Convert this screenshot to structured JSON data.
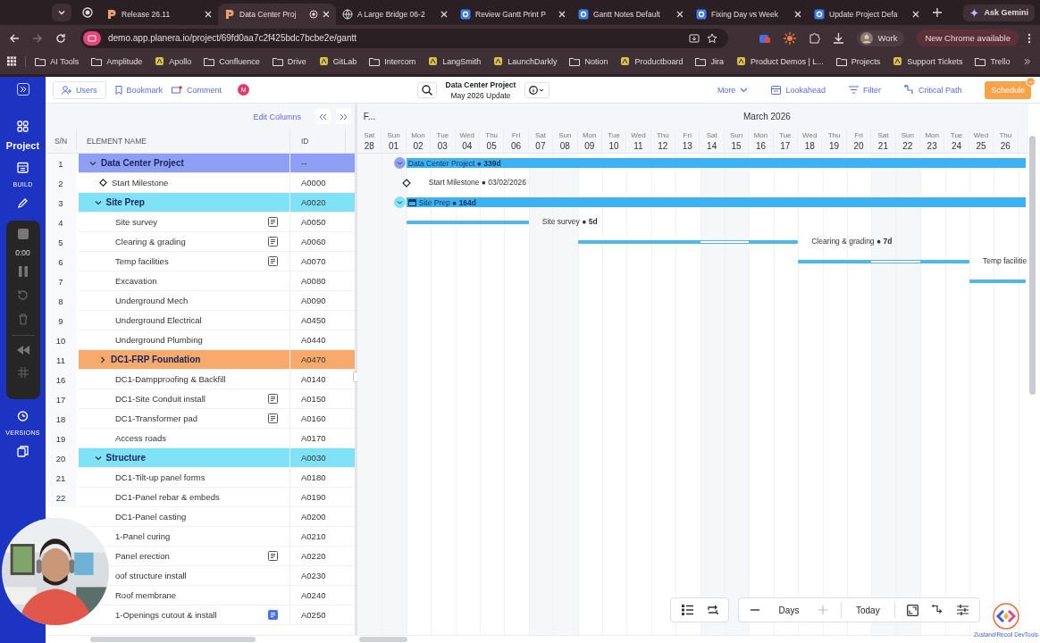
{
  "browser": {
    "tabs": [
      {
        "title": "Release 26.11",
        "kind": "planera",
        "selected": false
      },
      {
        "title": "Data Center Proj",
        "kind": "planera",
        "selected": true
      },
      {
        "title": "A Large Bridge 06-2",
        "kind": "globe",
        "selected": false
      },
      {
        "title": "Review Gantt Print P",
        "kind": "doc",
        "selected": false
      },
      {
        "title": "Gantt Notes Default",
        "kind": "doc",
        "selected": false
      },
      {
        "title": "Fixing Day vs Week",
        "kind": "doc",
        "selected": false
      },
      {
        "title": "Update Project Defa",
        "kind": "doc",
        "selected": false
      }
    ],
    "gemini_button": "Ask Gemini",
    "url": "demo.app.planera.io/project/69fd0aa7c2f425bdc7bcbe2e/gantt",
    "profile": "Work",
    "update_button": "New Chrome available",
    "bookmarks": [
      {
        "label": "AI Tools",
        "kind": "folder"
      },
      {
        "label": "Amplitude",
        "kind": "folder"
      },
      {
        "label": "Apollo",
        "kind": "site"
      },
      {
        "label": "Confluence",
        "kind": "folder"
      },
      {
        "label": "Drive",
        "kind": "folder"
      },
      {
        "label": "GitLab",
        "kind": "site"
      },
      {
        "label": "Intercom",
        "kind": "folder"
      },
      {
        "label": "LangSmith",
        "kind": "site"
      },
      {
        "label": "LaunchDarkly",
        "kind": "site"
      },
      {
        "label": "Notion",
        "kind": "folder"
      },
      {
        "label": "Productboard",
        "kind": "site"
      },
      {
        "label": "Jira",
        "kind": "folder"
      },
      {
        "label": "Product Demos | L...",
        "kind": "site"
      },
      {
        "label": "Projects",
        "kind": "folder"
      },
      {
        "label": "Support Tickets",
        "kind": "site"
      },
      {
        "label": "Trello",
        "kind": "folder"
      }
    ]
  },
  "sidebar": {
    "project_label": "Project",
    "build_label": "BUILD",
    "versions_label": "VERSIONS",
    "recorder_time": "0:00"
  },
  "toolbar": {
    "users": "Users",
    "bookmark": "Bookmark",
    "comment": "Comment",
    "avatar": "M",
    "project_title": "Data Center Project",
    "update_name": "May 2026 Update",
    "more": "More",
    "lookahead": "Lookahead",
    "filter": "Filter",
    "critical_path": "Critical Path",
    "schedule": "Schedule"
  },
  "table": {
    "edit_columns": "Edit Columns",
    "columns": [
      "S/N",
      "ELEMENT NAME",
      "ID"
    ],
    "rows": [
      {
        "sn": "1",
        "name": "Data Center Project",
        "id": "--",
        "kind": "group",
        "color": "#8f9ff3",
        "expanded": true,
        "note": false,
        "children": [
          {
            "sn": "2",
            "name": "Start Milestone",
            "id": "A0000",
            "kind": "milestone",
            "note": false
          },
          {
            "sn": "3",
            "name": "Site Prep",
            "id": "A0020",
            "kind": "group",
            "color": "#80e2f6",
            "expanded": true,
            "note": false,
            "children": [
              {
                "sn": "4",
                "name": "Site survey",
                "id": "A0050",
                "kind": "task",
                "note": true
              },
              {
                "sn": "5",
                "name": "Clearing & grading",
                "id": "A0060",
                "kind": "task",
                "note": true
              },
              {
                "sn": "6",
                "name": "Temp facilities",
                "id": "A0070",
                "kind": "task",
                "note": true
              },
              {
                "sn": "7",
                "name": "Excavation",
                "id": "A0080",
                "kind": "task",
                "note": false
              },
              {
                "sn": "8",
                "name": "Underground Mech",
                "id": "A0090",
                "kind": "task",
                "note": false
              },
              {
                "sn": "9",
                "name": "Underground Electrical",
                "id": "A0450",
                "kind": "task",
                "note": false
              },
              {
                "sn": "10",
                "name": "Underground Plumbing",
                "id": "A0440",
                "kind": "task",
                "note": false
              },
              {
                "sn": "11",
                "name": "DC1-FRP Foundation",
                "id": "A0470",
                "kind": "group",
                "color": "#f7aa6c",
                "expanded": false,
                "note": false
              },
              {
                "sn": "16",
                "name": "DC1-Dampproofing & Backfill",
                "id": "A0140",
                "kind": "task",
                "note": false
              },
              {
                "sn": "17",
                "name": "DC1-Site Conduit install",
                "id": "A0150",
                "kind": "task",
                "note": true
              },
              {
                "sn": "18",
                "name": "DC1-Transformer pad",
                "id": "A0160",
                "kind": "task",
                "note": true
              },
              {
                "sn": "19",
                "name": "Access roads",
                "id": "A0170",
                "kind": "task",
                "note": false
              }
            ]
          },
          {
            "sn": "20",
            "name": "Structure",
            "id": "A0030",
            "kind": "group",
            "color": "#80e2f6",
            "expanded": true,
            "note": false,
            "children": [
              {
                "sn": "21",
                "name": "DC1-Tilt-up panel forms",
                "id": "A0180",
                "kind": "task",
                "note": false
              },
              {
                "sn": "22",
                "name": "DC1-Panel rebar & embeds",
                "id": "A0190",
                "kind": "task",
                "note": false
              },
              {
                "name": "DC1-Panel casting",
                "id": "A0200",
                "kind": "task",
                "note": false
              },
              {
                "name": "1-Panel curing",
                "id": "A0210",
                "kind": "task",
                "note": false
              },
              {
                "name": "Panel erection",
                "id": "A0220",
                "kind": "task",
                "note": true
              },
              {
                "name": "oof structure install",
                "id": "A0230",
                "kind": "task",
                "note": false
              },
              {
                "name": "Roof membrane",
                "id": "A0240",
                "kind": "task",
                "note": false
              },
              {
                "name": "1-Openings cutout & install",
                "id": "A0250",
                "kind": "task",
                "note": true,
                "highlighted_note": true
              }
            ]
          }
        ]
      }
    ]
  },
  "gantt": {
    "header_cut": "F...",
    "month": "March 2026",
    "days": [
      {
        "dow": "Sat",
        "date": "28"
      },
      {
        "dow": "Sun",
        "date": "01"
      },
      {
        "dow": "Mon",
        "date": "02"
      },
      {
        "dow": "Tue",
        "date": "03"
      },
      {
        "dow": "Wed",
        "date": "04"
      },
      {
        "dow": "Thu",
        "date": "05"
      },
      {
        "dow": "Fri",
        "date": "06"
      },
      {
        "dow": "Sat",
        "date": "07"
      },
      {
        "dow": "Sun",
        "date": "08"
      },
      {
        "dow": "Mon",
        "date": "09"
      },
      {
        "dow": "Tue",
        "date": "10"
      },
      {
        "dow": "Wed",
        "date": "11"
      },
      {
        "dow": "Thu",
        "date": "12"
      },
      {
        "dow": "Fri",
        "date": "13"
      },
      {
        "dow": "Sat",
        "date": "14"
      },
      {
        "dow": "Sun",
        "date": "15"
      },
      {
        "dow": "Mon",
        "date": "16"
      },
      {
        "dow": "Tue",
        "date": "17"
      },
      {
        "dow": "Wed",
        "date": "18"
      },
      {
        "dow": "Thu",
        "date": "19"
      },
      {
        "dow": "Fri",
        "date": "20"
      },
      {
        "dow": "Sat",
        "date": "21"
      },
      {
        "dow": "Sun",
        "date": "22"
      },
      {
        "dow": "Mon",
        "date": "23"
      },
      {
        "dow": "Tue",
        "date": "24"
      },
      {
        "dow": "Wed",
        "date": "25"
      },
      {
        "dow": "Thu",
        "date": "26"
      }
    ],
    "bars": [
      {
        "kind": "summary",
        "label": "Data Center Project ● **339d**",
        "color": "#8f9ff3"
      },
      {
        "kind": "milestone",
        "label": "Start Milestone ● 03/02/2026"
      },
      {
        "kind": "summary",
        "label": "Site Prep ● **164d**",
        "color": "#80e2f6"
      },
      {
        "kind": "task",
        "label": "Site survey ● **5d**"
      },
      {
        "kind": "task",
        "label": "Clearing & grading ● **7d**"
      },
      {
        "kind": "task",
        "label": "Temp facilitie"
      },
      {
        "kind": "task"
      }
    ],
    "scale": "Days",
    "today": "Today",
    "devtools": "Zustand/Recoil DevTools"
  }
}
